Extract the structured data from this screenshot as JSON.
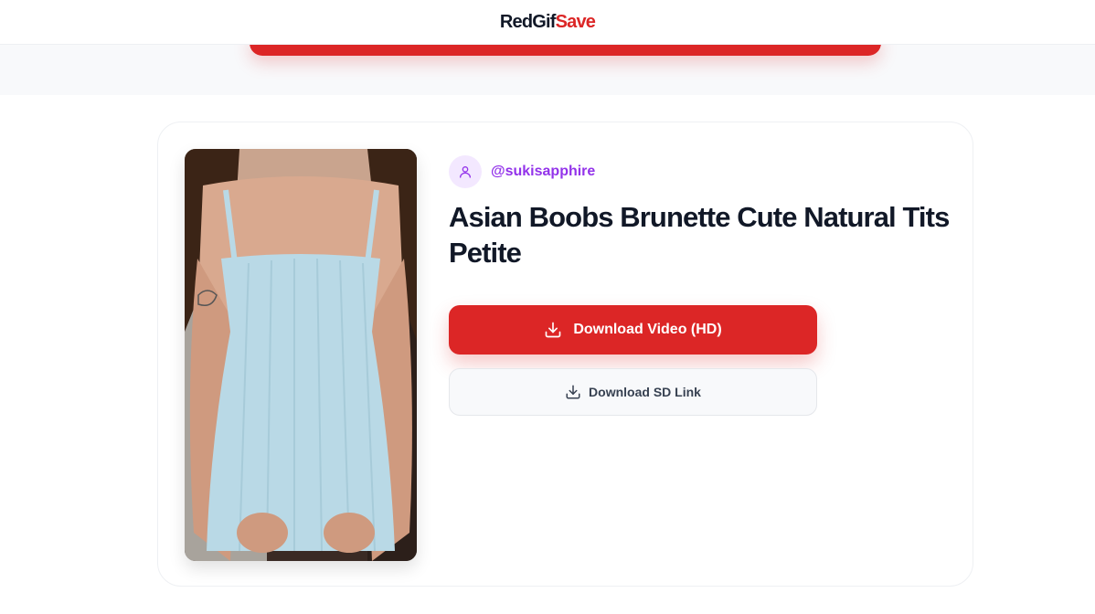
{
  "header": {
    "logo_dark": "RedGif",
    "logo_accent": "Save"
  },
  "video": {
    "author": "@sukisapphire",
    "title": "Asian Boobs Brunette Cute Natural Tits Petite",
    "thumbnail_alt": "Video thumbnail"
  },
  "actions": {
    "download_hd_label": "Download Video (HD)",
    "download_sd_label": "Download SD Link"
  },
  "colors": {
    "brand_red": "#dc2626",
    "username_purple": "#9333ea",
    "avatar_bg": "#f3e8ff",
    "title_text": "#111827"
  },
  "icons": {
    "user": "user-icon",
    "download": "download-icon"
  }
}
